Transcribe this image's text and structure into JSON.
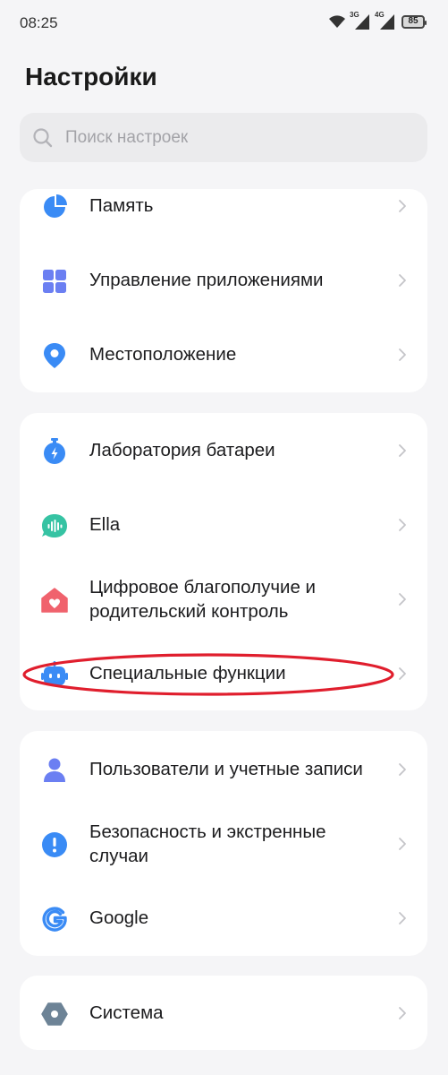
{
  "status_bar": {
    "time": "08:25",
    "net1": "3G",
    "net2": "4G",
    "battery": "85"
  },
  "header": {
    "title": "Настройки"
  },
  "search": {
    "placeholder": "Поиск настроек"
  },
  "colors": {
    "blue": "#3a8bf5",
    "purple": "#6b7ff2",
    "green": "#36c3a3",
    "red": "#f0626d",
    "gray_hex": "#6d8396",
    "annotation": "#e01e2d"
  },
  "groups": [
    {
      "items": [
        {
          "label": "Память",
          "icon": "storage-pie-icon"
        },
        {
          "label": "Управление приложениями",
          "icon": "apps-grid-icon"
        },
        {
          "label": "Местоположение",
          "icon": "location-pin-icon"
        }
      ]
    },
    {
      "items": [
        {
          "label": "Лаборатория батареи",
          "icon": "battery-lab-icon"
        },
        {
          "label": "Ella",
          "icon": "ella-voice-icon"
        },
        {
          "label": "Цифровое благополучие и родительский контроль",
          "icon": "home-heart-icon"
        },
        {
          "label": "Специальные функции",
          "icon": "robot-icon"
        }
      ]
    },
    {
      "items": [
        {
          "label": "Пользователи и учетные записи",
          "icon": "user-icon"
        },
        {
          "label": "Безопасность и экстренные случаи",
          "icon": "alert-icon"
        },
        {
          "label": "Google",
          "icon": "google-icon"
        }
      ]
    },
    {
      "items": [
        {
          "label": "Система",
          "icon": "system-hexagon-icon"
        }
      ]
    }
  ]
}
